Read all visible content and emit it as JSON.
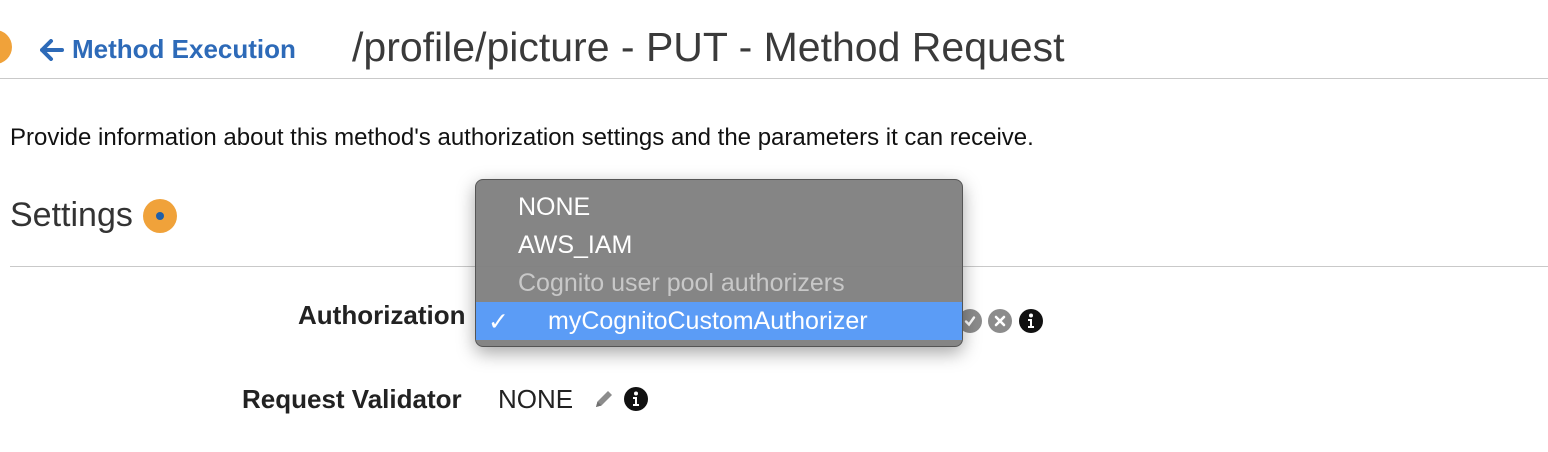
{
  "header": {
    "back_label": "Method Execution",
    "title": "/profile/picture - PUT - Method Request"
  },
  "description": "Provide information about this method's authorization settings and the parameters it can receive.",
  "settings": {
    "heading": "Settings",
    "authorization": {
      "label": "Authorization",
      "dropdown": {
        "items": [
          {
            "label": "NONE",
            "type": "option"
          },
          {
            "label": "AWS_IAM",
            "type": "option"
          },
          {
            "label": "Cognito user pool authorizers",
            "type": "group-header"
          },
          {
            "label": "myCognitoCustomAuthorizer",
            "type": "option",
            "selected": true
          }
        ],
        "check_mark": "✓"
      }
    },
    "request_validator": {
      "label": "Request Validator",
      "value": "NONE"
    }
  },
  "icons": {
    "back": "arrow-left-icon",
    "help": "help-dot-icon",
    "edit": "pencil-icon",
    "info": "info-icon",
    "confirm": "check-circle-icon",
    "cancel": "x-circle-icon"
  },
  "colors": {
    "link": "#2d6ab8",
    "help_dot": "#f0a23a",
    "dropdown_bg": "#808080",
    "dropdown_selected": "#5b9cf6"
  }
}
